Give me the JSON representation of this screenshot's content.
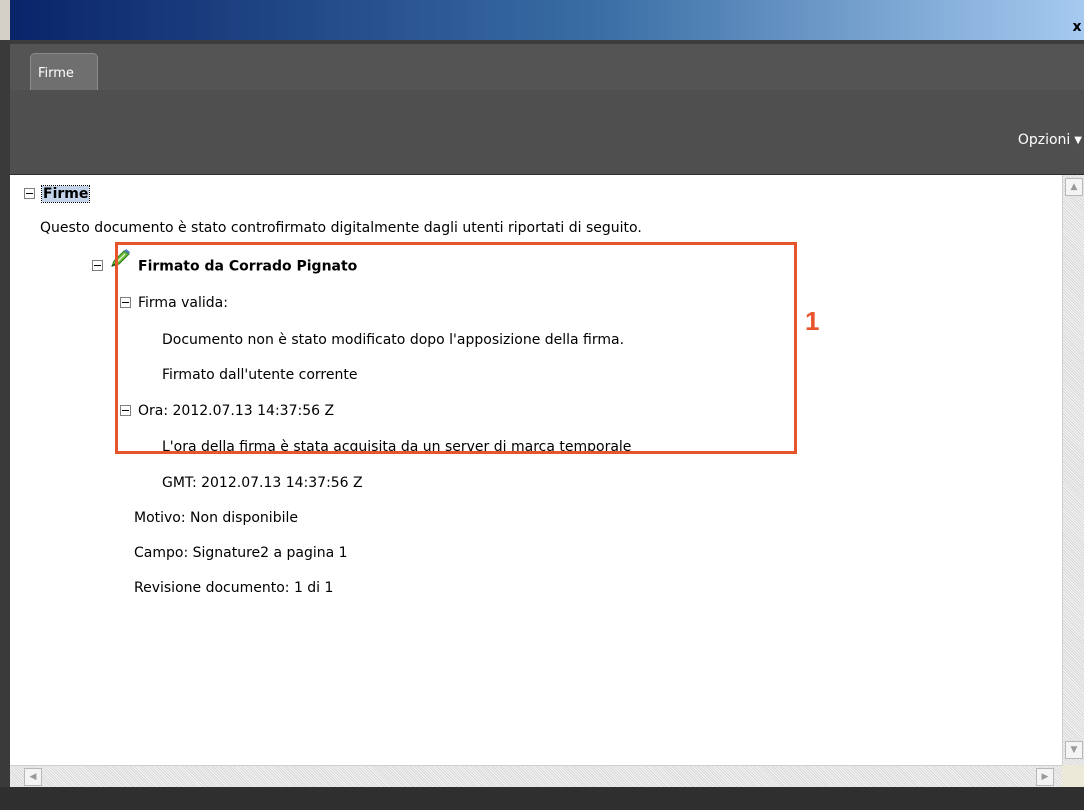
{
  "window": {
    "close_label": "x"
  },
  "tabs": [
    {
      "label": "Firme"
    }
  ],
  "toolbar": {
    "options_label": "Opzioni",
    "options_arrow": "▼"
  },
  "tree": {
    "root_label": "Firme",
    "description": "Questo documento è stato controfirmato digitalmente dagli utenti riportati di seguito.",
    "signer_label": "Firmato da Corrado Pignato",
    "valid_label": "Firma valida:",
    "valid_details": [
      "Documento non è stato modificato dopo l'apposizione della firma.",
      "Firmato dall'utente corrente"
    ],
    "time_label": "Ora: 2012.07.13 14:37:56 Z",
    "time_details": [
      "L'ora della firma è stata acquisita da un server di marca temporale",
      "GMT: 2012.07.13 14:37:56 Z"
    ],
    "reason": "Motivo: Non disponibile",
    "field": "Campo: Signature2 a pagina 1",
    "revision": "Revisione documento: 1 di 1"
  },
  "annotation": {
    "label": "1",
    "color": "#e8542c"
  },
  "colors": {
    "titlebar_start": "#0a246a",
    "panel_dark": "#4f4f4f",
    "selection": "#c2d3ea"
  }
}
